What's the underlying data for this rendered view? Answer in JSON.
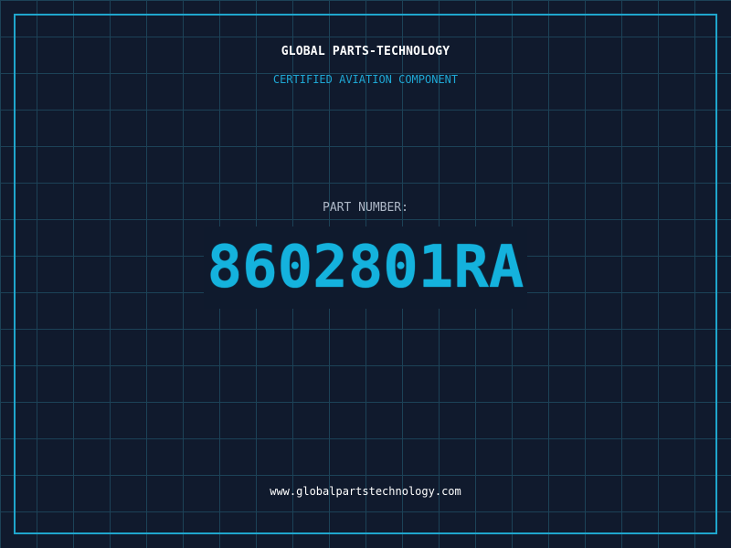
{
  "header": {
    "company": "GLOBAL PARTS-TECHNOLOGY",
    "tagline": "CERTIFIED AVIATION COMPONENT"
  },
  "part": {
    "label": "PART NUMBER:",
    "number": "8602801RA"
  },
  "footer": {
    "website": "www.globalpartstechnology.com"
  },
  "colors": {
    "background": "#101a2d",
    "grid": "#1c4257",
    "accent": "#1fa6cc",
    "part_number": "#14b2dd"
  }
}
